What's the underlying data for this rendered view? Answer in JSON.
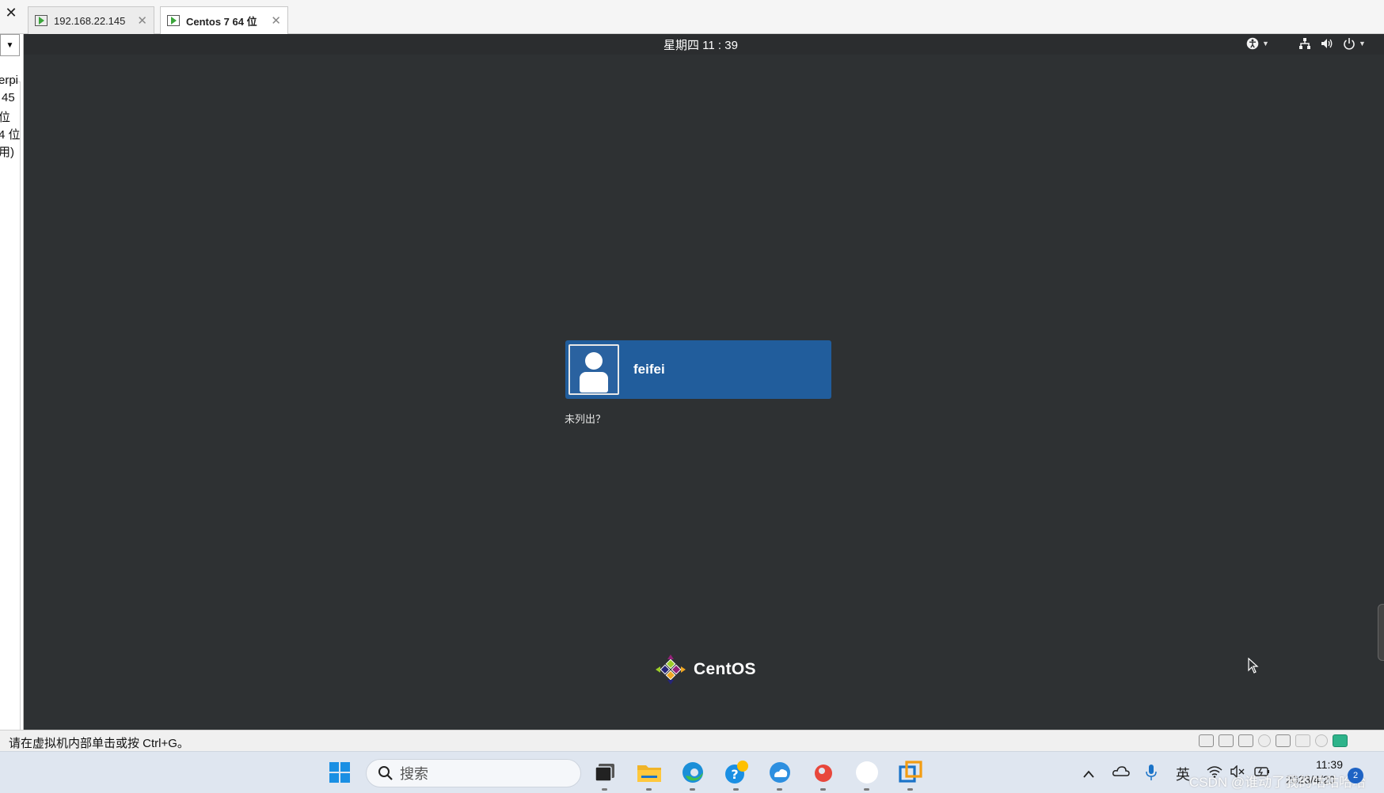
{
  "tabs": [
    {
      "label": "192.168.22.145",
      "active": false
    },
    {
      "label": "Centos 7 64 位",
      "active": true
    }
  ],
  "sidebar": {
    "lines": [
      "erpi",
      "45",
      "位",
      "4 位",
      "用)"
    ]
  },
  "vm": {
    "topbar": {
      "clock": "星期四 11 : 39"
    },
    "login": {
      "user": "feifei",
      "not_listed": "未列出？"
    },
    "logo_text": "CentOS"
  },
  "statusbar": {
    "text": "请在虚拟机内部单击或按 Ctrl+G。"
  },
  "taskbar": {
    "search_placeholder": "搜索",
    "ime": "英",
    "time": "11:39",
    "date": "2023/4/20",
    "watermark": "CSDN @谁动了我的咕咕哈哈",
    "notification_count": "2"
  },
  "colors": {
    "vm_background": "#2e3133",
    "gnome_bar": "#2b2d2f",
    "user_card": "#215d9c",
    "taskbar": "#dfe6f0"
  }
}
